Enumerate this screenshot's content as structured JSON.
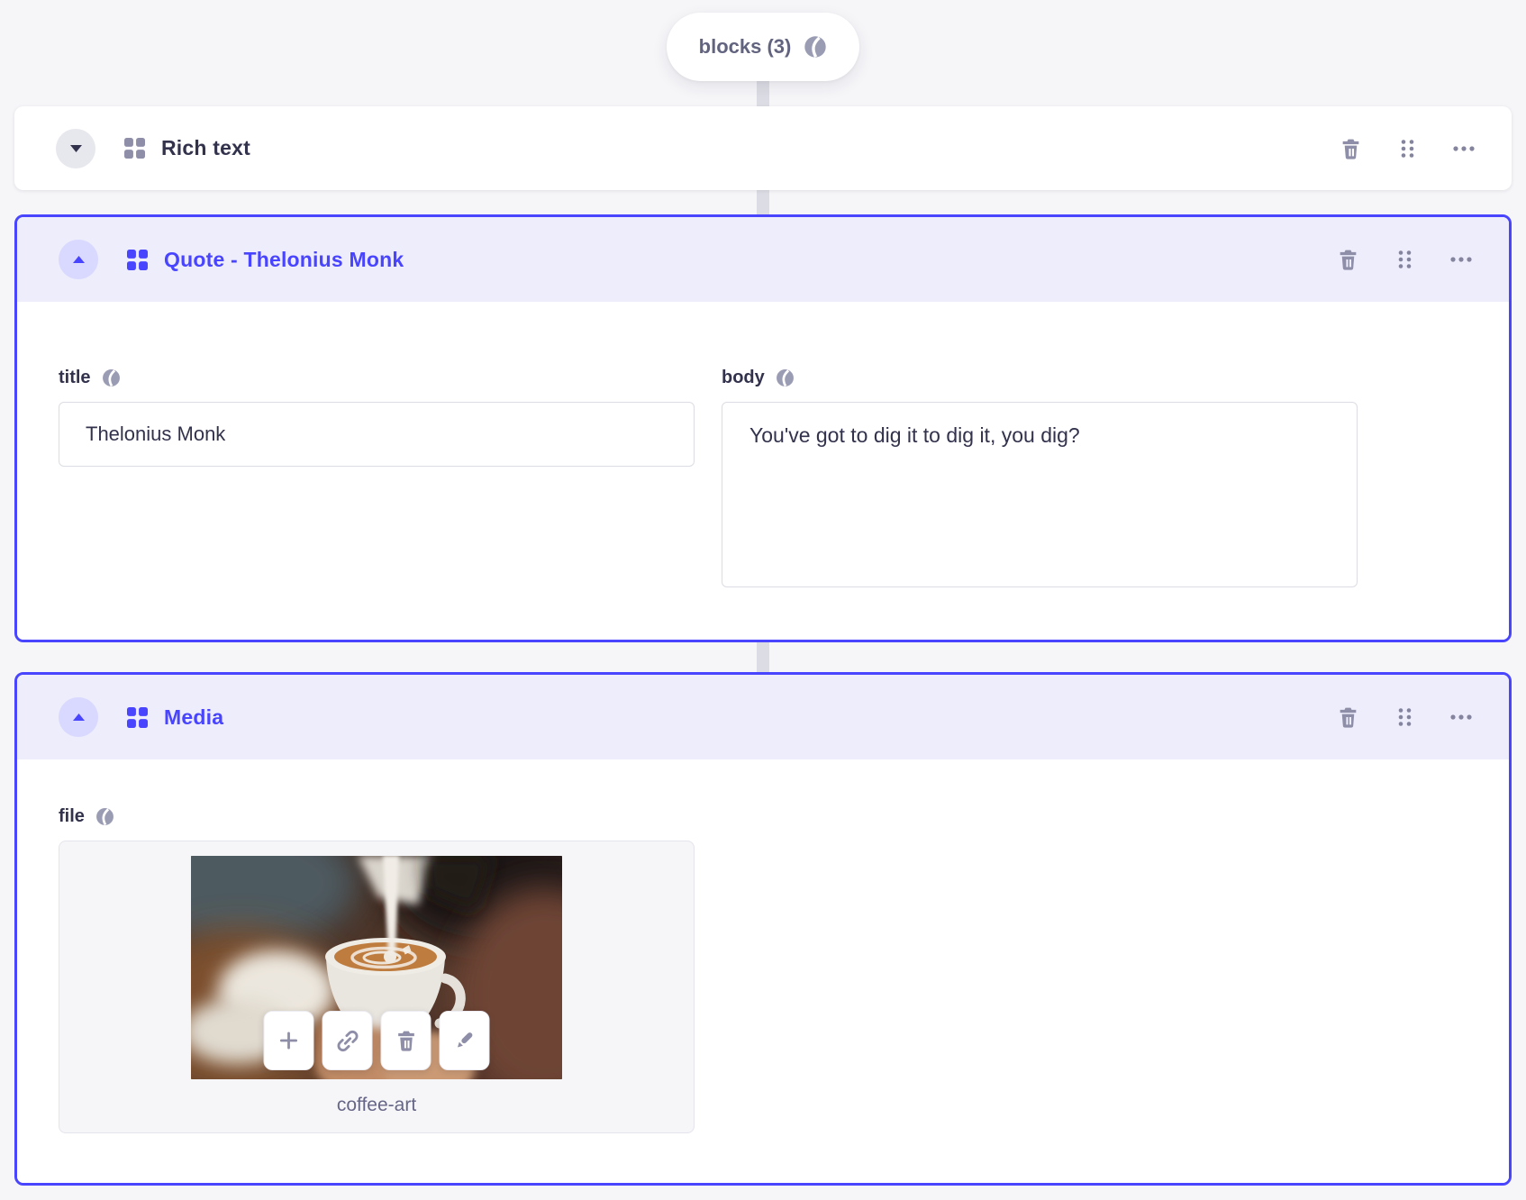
{
  "colors": {
    "primary": "#4945ff",
    "selected_header_bg": "#eeedfc",
    "selected_toggle_bg": "#d9d8ff",
    "page_bg": "#f6f6f9",
    "text_dark": "#32324d",
    "muted_icon": "#8e8ea9",
    "muted_text": "#666687",
    "input_border": "#dcdce4",
    "connector": "#dcdce4"
  },
  "icons": {
    "pill_icon": "globe-icon",
    "block_type_icon": "blocks-grid-icon",
    "header_action_icons": [
      "trash-icon",
      "drag-handle-icon",
      "ellipsis-icon"
    ],
    "media_toolbar_icons": [
      "plus-icon",
      "link-icon",
      "trash-icon",
      "pencil-icon"
    ],
    "field_locale_icon": "globe-icon"
  },
  "array_field": {
    "label": "blocks (3)"
  },
  "blocks": [
    {
      "title": "Rich text",
      "collapsed": true
    },
    {
      "title": "Quote - Thelonius Monk",
      "collapsed": false,
      "fields": {
        "title": {
          "label": "title",
          "value": "Thelonius Monk"
        },
        "body": {
          "label": "body",
          "value": "You've got to dig it to dig it, you dig?"
        }
      }
    },
    {
      "title": "Media",
      "collapsed": false,
      "fields": {
        "file": {
          "label": "file",
          "file_name": "coffee-art"
        }
      }
    }
  ]
}
